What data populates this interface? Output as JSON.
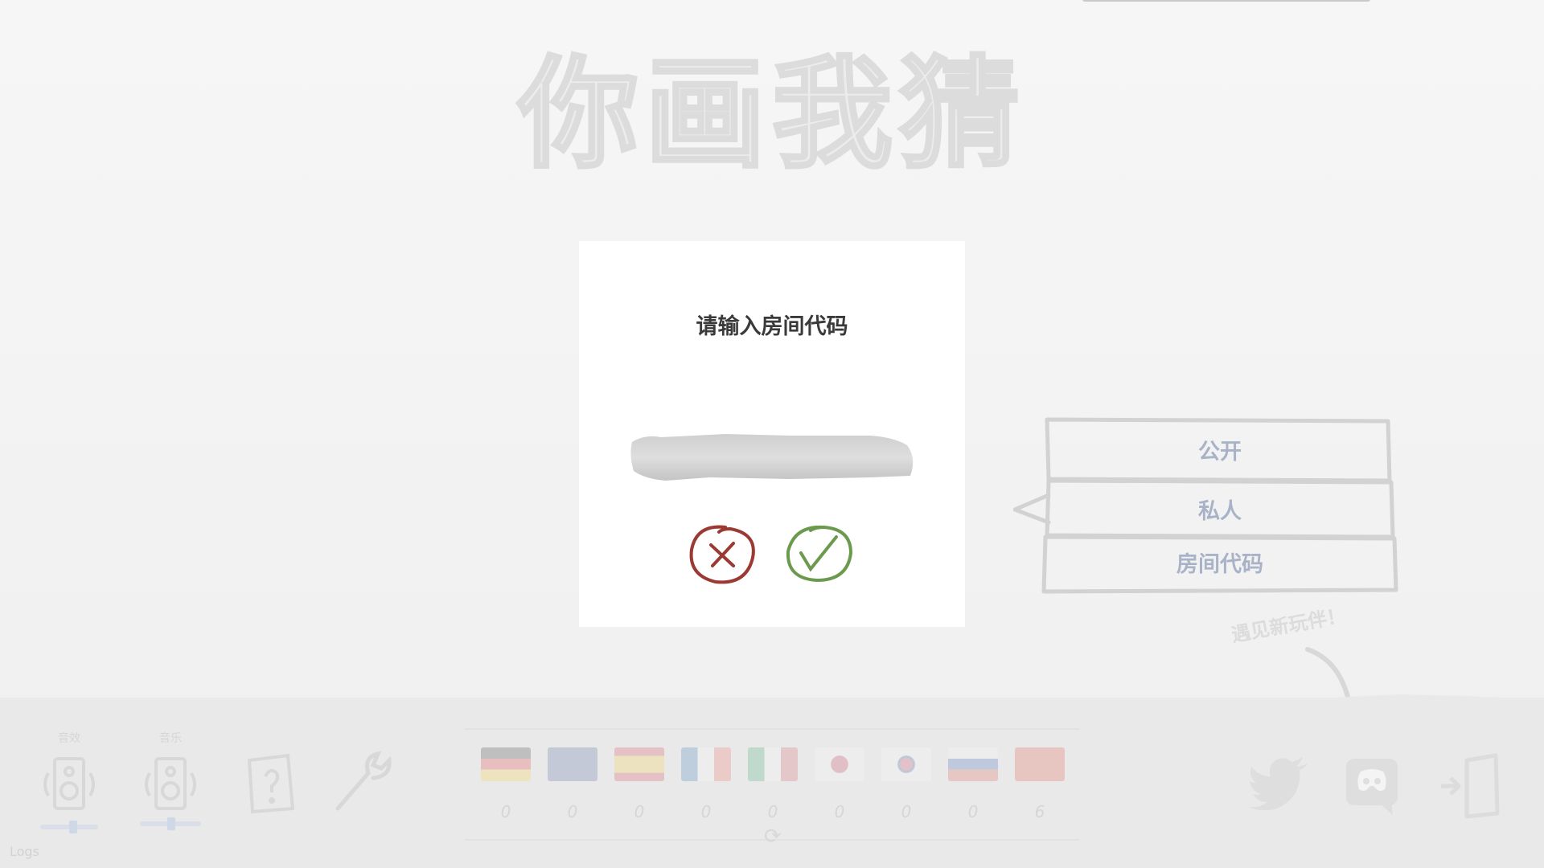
{
  "game": {
    "title": "你画我猜"
  },
  "dialog": {
    "title": "请输入房间代码",
    "input_value": "",
    "input_placeholder": ""
  },
  "room_menu": {
    "items": [
      {
        "label": "公开"
      },
      {
        "label": "私人"
      },
      {
        "label": "房间代码"
      }
    ]
  },
  "meet_players": "遇见新玩伴！",
  "controls": {
    "sound_label": "音效",
    "music_label": "音乐",
    "logs_label": "Logs"
  },
  "languages": [
    {
      "flag": "german-flag",
      "count": "0"
    },
    {
      "flag": "uk-flag",
      "count": "0"
    },
    {
      "flag": "spanish-flag",
      "count": "0"
    },
    {
      "flag": "french-flag",
      "count": "0"
    },
    {
      "flag": "italian-flag",
      "count": "0"
    },
    {
      "flag": "japanese-flag",
      "count": "0"
    },
    {
      "flag": "korean-flag",
      "count": "0"
    },
    {
      "flag": "russian-flag",
      "count": "0"
    },
    {
      "flag": "chinese-flag",
      "count": "6"
    }
  ],
  "colors": {
    "cancel": "#9a3a32",
    "confirm": "#6b9a4e",
    "menu_text": "#a9b3c8",
    "title_text": "#3a3a3a"
  }
}
